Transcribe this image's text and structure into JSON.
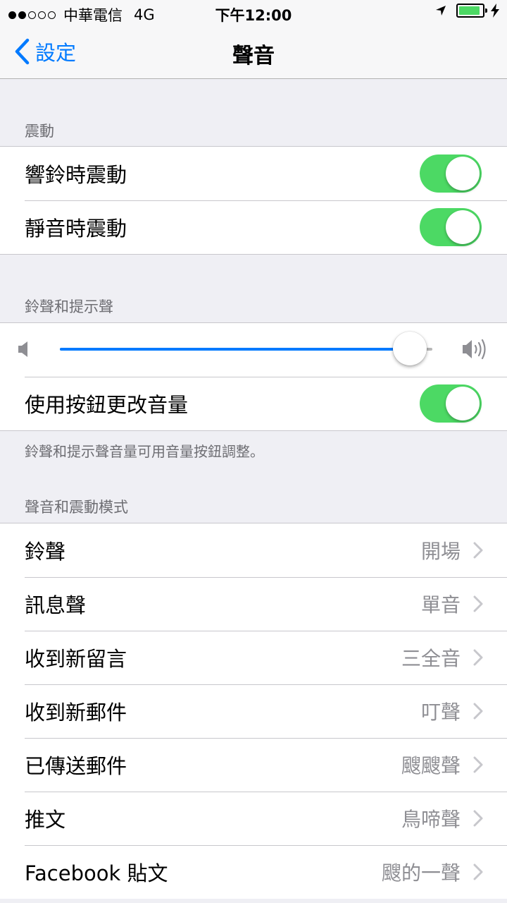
{
  "status": {
    "signal_dots_filled": 2,
    "signal_dots_total": 5,
    "carrier": "中華電信",
    "network": "4G",
    "time": "下午12:00",
    "battery_level": 0.9
  },
  "nav": {
    "back_label": "設定",
    "title": "聲音"
  },
  "vibration": {
    "header": "震動",
    "rows": [
      {
        "label": "響鈴時震動",
        "on": true
      },
      {
        "label": "靜音時震動",
        "on": true
      }
    ]
  },
  "ringer": {
    "header": "鈴聲和提示聲",
    "volume": 0.94,
    "button_row": {
      "label": "使用按鈕更改音量",
      "on": true
    },
    "footer": "鈴聲和提示聲音量可用音量按鈕調整。"
  },
  "patterns": {
    "header": "聲音和震動模式",
    "rows": [
      {
        "label": "鈴聲",
        "value": "開場"
      },
      {
        "label": "訊息聲",
        "value": "單音"
      },
      {
        "label": "收到新留言",
        "value": "三全音"
      },
      {
        "label": "收到新郵件",
        "value": "叮聲"
      },
      {
        "label": "已傳送郵件",
        "value": "颼颼聲"
      },
      {
        "label": "推文",
        "value": "鳥啼聲"
      },
      {
        "label": "Facebook 貼文",
        "value": "颼的一聲"
      }
    ]
  },
  "colors": {
    "accent": "#007aff",
    "toggle_on": "#4cd964"
  }
}
